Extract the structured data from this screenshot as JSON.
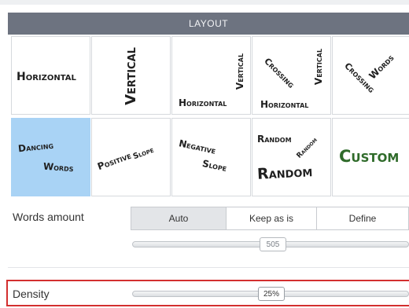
{
  "header": {
    "title": "LAYOUT"
  },
  "tiles": [
    {
      "words": [
        "Horizontal"
      ]
    },
    {
      "words": [
        "Vertical"
      ]
    },
    {
      "words": [
        "Vertical",
        "Horizontal"
      ]
    },
    {
      "words": [
        "Crossing",
        "Vertical",
        "Horizontal"
      ]
    },
    {
      "words": [
        "Crossing",
        "Words"
      ]
    },
    {
      "words": [
        "Dancing",
        "Words"
      ],
      "selected": true
    },
    {
      "words": [
        "Positive",
        "Slope"
      ]
    },
    {
      "words": [
        "Negative",
        "Slope"
      ]
    },
    {
      "words": [
        "Random",
        "Random",
        "Random"
      ]
    },
    {
      "words": [
        "Custom"
      ]
    }
  ],
  "words_amount": {
    "label": "Words amount",
    "options": [
      "Auto",
      "Keep as is",
      "Define"
    ],
    "selected": "Auto",
    "slider_value": "505"
  },
  "density": {
    "label": "Density",
    "slider_value": "25%"
  },
  "colors": {
    "selected_tile": "#a9d3f5",
    "header_bg": "#6d7380",
    "highlight": "#d32f2f",
    "custom_text": "#2f6b2a"
  }
}
